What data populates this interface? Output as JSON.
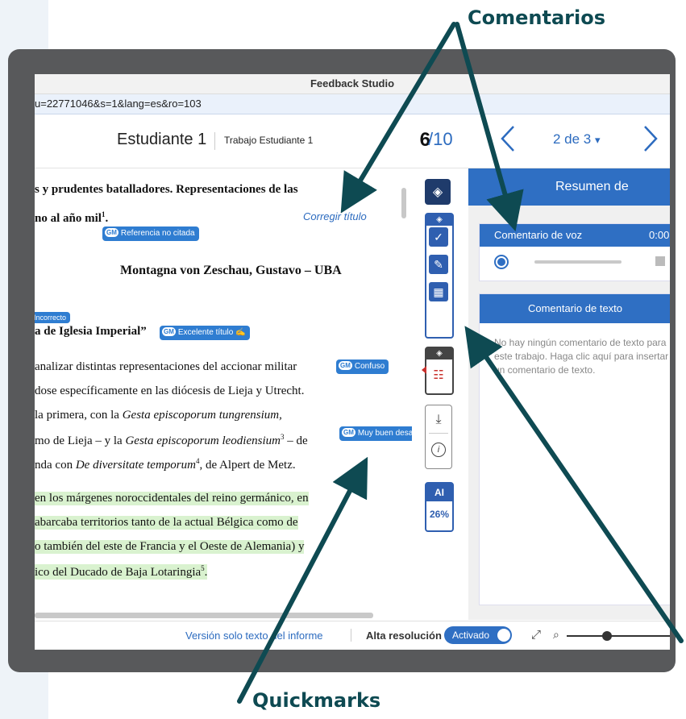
{
  "callouts": {
    "comentarios": "Comentarios",
    "quickmarks": "Quickmarks"
  },
  "window": {
    "title": "Feedback Studio",
    "url": "u=22771046&s=1&lang=es&ro=103"
  },
  "header": {
    "student": "Estudiante 1",
    "work": "Trabajo Estudiante 1",
    "grade": "6",
    "grade_total": "/10",
    "pager": "2 de 3",
    "pager_caret": "▾"
  },
  "document": {
    "lines": [
      "s y prudentes batalladores. Representaciones de las",
      "no al año mil",
      "Montagna von Zeschau, Gustavo – UBA",
      "a de Iglesia Imperial”",
      "analizar distintas representaciones del accionar militar",
      "dose específicamente en las diócesis de Lieja y Utrecht.",
      "la primera, con la",
      "Gesta episcoporum tungrensium,",
      "mo de Lieja –  y la",
      "Gesta episcoporum leodiensium",
      " – de",
      "nda con",
      "De diversitate temporum",
      ", de Alpert de Metz.",
      "en los márgenes noroccidentales del reino germánico, en",
      "abarcaba territorios tanto de la actual Bélgica como de",
      "o también del este de Francia y el Oeste de Alemania) y",
      "ico del Ducado de Baja Lotaringia",
      "."
    ],
    "footnotes": [
      "1",
      "3",
      "4",
      "5"
    ],
    "correction": "Corregir título"
  },
  "quickmarks": {
    "gm": "GM",
    "referencia": "Referencia no citada",
    "incorrecto": "Incorrecto",
    "excelente": "Excelente título",
    "confuso": "Confuso",
    "muy_bueno": "Muy buen desa"
  },
  "toolbar": {
    "ai_label": "AI",
    "ai_percent": "26%"
  },
  "panel": {
    "title": "Resumen de",
    "voice_title": "Comentario de voz",
    "voice_time": "0:00",
    "text_title": "Comentario de texto",
    "text_body": "No hay ningún comentario de texto para este trabajo. Haga clic aquí para insertar un comentario de texto."
  },
  "status": {
    "text_only": "Versión solo texto del informe",
    "high_res": "Alta resolución",
    "toggle": "Activado"
  },
  "colors": {
    "accent": "#2f6fc3",
    "callout": "#0e4a52",
    "highlight": "#d9f2cf",
    "frame": "#58595b"
  },
  "icons": {
    "layers": "layers-icon",
    "check": "check-icon",
    "edit": "edit-icon",
    "grid": "grid-icon",
    "document": "document-icon",
    "download": "download-icon",
    "info": "info-icon",
    "expand": "expand-icon",
    "zoom": "zoom-out-icon",
    "record": "record-icon",
    "stop": "stop-icon"
  }
}
